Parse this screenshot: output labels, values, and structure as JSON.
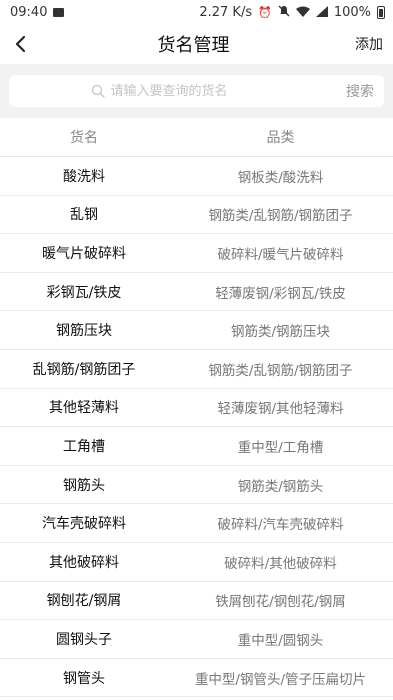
{
  "status": {
    "time": "09:40",
    "speed": "2.27 K/s",
    "battery": "100%"
  },
  "header": {
    "title": "货名管理",
    "add_label": "添加"
  },
  "search": {
    "placeholder": "请输入要查询的货名",
    "button_label": "搜索"
  },
  "table": {
    "headers": [
      "货名",
      "品类"
    ],
    "rows": [
      {
        "name": "酸洗料",
        "category": "钢板类/酸洗料"
      },
      {
        "name": "乱钢",
        "category": "钢筋类/乱钢筋/钢筋团子"
      },
      {
        "name": "暖气片破碎料",
        "category": "破碎料/暖气片破碎料"
      },
      {
        "name": "彩钢瓦/铁皮",
        "category": "轻薄废钢/彩钢瓦/铁皮"
      },
      {
        "name": "钢筋压块",
        "category": "钢筋类/钢筋压块"
      },
      {
        "name": "乱钢筋/钢筋团子",
        "category": "钢筋类/乱钢筋/钢筋团子"
      },
      {
        "name": "其他轻薄料",
        "category": "轻薄废钢/其他轻薄料"
      },
      {
        "name": "工角槽",
        "category": "重中型/工角槽"
      },
      {
        "name": "钢筋头",
        "category": "钢筋类/钢筋头"
      },
      {
        "name": "汽车壳破碎料",
        "category": "破碎料/汽车壳破碎料"
      },
      {
        "name": "其他破碎料",
        "category": "破碎料/其他破碎料"
      },
      {
        "name": "钢刨花/钢屑",
        "category": "铁屑刨花/钢刨花/钢屑"
      },
      {
        "name": "圆钢头子",
        "category": "重中型/圆钢头"
      },
      {
        "name": "钢管头",
        "category": "重中型/钢管头/管子压扁切片"
      }
    ]
  }
}
